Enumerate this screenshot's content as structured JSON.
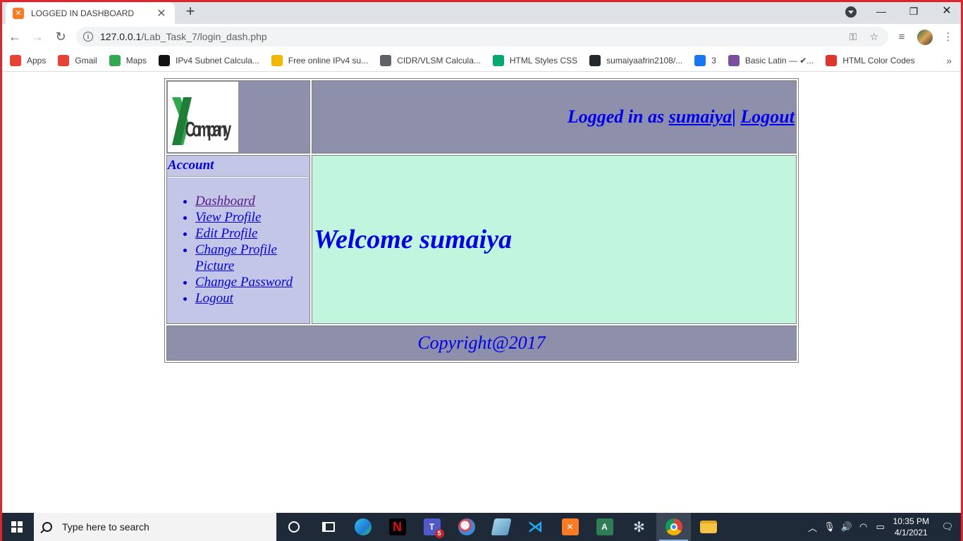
{
  "browser": {
    "tab_title": "LOGGED IN DASHBOARD",
    "url_host": "127.0.0.1",
    "url_path": "/Lab_Task_7/login_dash.php",
    "bookmarks": [
      {
        "label": "Apps",
        "icon": "apps-grid-icon",
        "color": "#ea4335"
      },
      {
        "label": "Gmail",
        "icon": "gmail-icon",
        "color": "#ea4335"
      },
      {
        "label": "Maps",
        "icon": "maps-icon",
        "color": "#34a853"
      },
      {
        "label": "IPv4 Subnet Calcula...",
        "icon": "n-icon",
        "color": "#111111"
      },
      {
        "label": "Free online IPv4 su...",
        "icon": "a-icon",
        "color": "#f5b800"
      },
      {
        "label": "CIDR/VLSM Calcula...",
        "icon": "globe-icon",
        "color": "#5f6368"
      },
      {
        "label": "HTML Styles CSS",
        "icon": "w3-icon",
        "color": "#04aa6d"
      },
      {
        "label": "sumaiyaafrin2108/...",
        "icon": "github-icon",
        "color": "#24292e"
      },
      {
        "label": "3",
        "icon": "facebook-icon",
        "color": "#1877f2"
      },
      {
        "label": "Basic Latin — ✔...",
        "icon": "ut-icon",
        "color": "#7b4fa0"
      },
      {
        "label": "HTML Color Codes",
        "icon": "color-wheel-icon",
        "color": "#e0342c"
      }
    ]
  },
  "page": {
    "logo_text": "Company",
    "logged_in_prefix": "Logged in as ",
    "username": "sumaiya",
    "separator": "|",
    "logout_label": "Logout",
    "sidebar_title": "Account",
    "menu": [
      "Dashboard",
      "View Profile",
      "Edit Profile",
      "Change Profile Picture",
      "Change Password",
      "Logout"
    ],
    "welcome": "Welcome sumaiya",
    "footer": "Copyright@2017",
    "colors": {
      "header_bg": "#8e8fab",
      "sidebar_bg": "#c4c6e7",
      "main_bg": "#c1f5de",
      "link": "#0000ee"
    }
  },
  "taskbar": {
    "search_placeholder": "Type here to search",
    "teams_badge": "5",
    "time": "10:35 PM",
    "date": "4/1/2021"
  }
}
